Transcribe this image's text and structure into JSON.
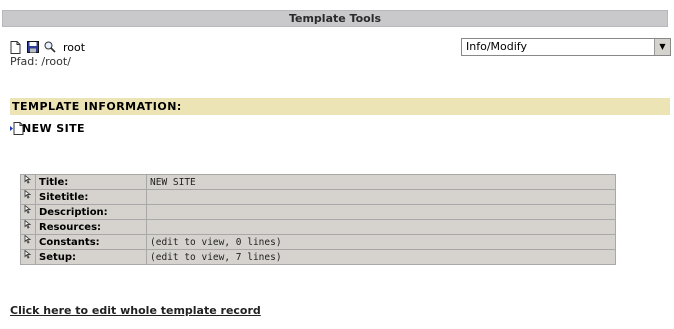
{
  "header": {
    "title": "Template Tools"
  },
  "toolbar": {
    "icons": [
      "page-icon",
      "save-icon",
      "search-icon"
    ],
    "root_label": "root",
    "path_text": "Pfad: /root/"
  },
  "mode_select": {
    "selected": "Info/Modify"
  },
  "section": {
    "title": "TEMPLATE INFORMATION:"
  },
  "site": {
    "label": "NEW SITE"
  },
  "info_rows": [
    {
      "label": "Title:",
      "value": "NEW SITE"
    },
    {
      "label": "Sitetitle:",
      "value": ""
    },
    {
      "label": "Description:",
      "value": ""
    },
    {
      "label": "Resources:",
      "value": ""
    },
    {
      "label": "Constants:",
      "value": "(edit to view, 0 lines)"
    },
    {
      "label": "Setup:",
      "value": "(edit to view, 7 lines)"
    }
  ],
  "footer": {
    "edit_link": "Click here to edit whole template record"
  }
}
